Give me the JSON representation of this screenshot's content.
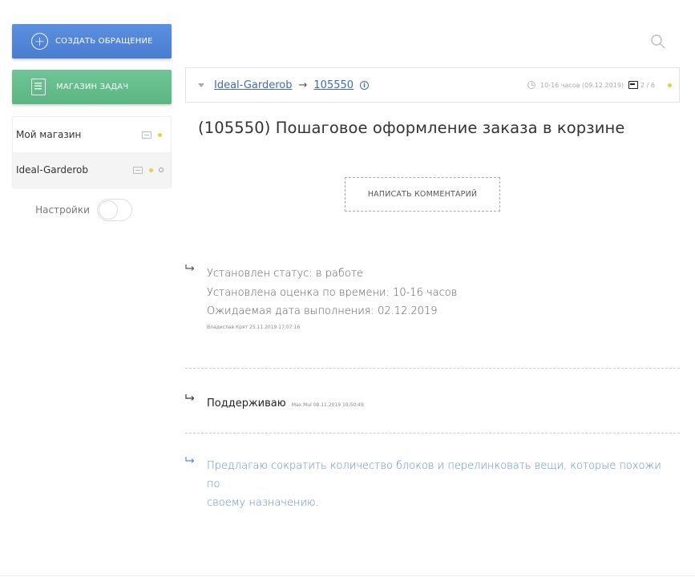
{
  "sidebar": {
    "create_label": "СОЗДАТЬ ОБРАЩЕНИЕ",
    "store_label": "МАГАЗИН ЗАДАЧ",
    "stores": [
      {
        "name": "Мой магазин"
      },
      {
        "name": "Ideal-Garderob"
      }
    ],
    "settings_label": "Настройки"
  },
  "breadcrumb": {
    "store": "Ideal-Garderob",
    "arrow": "→",
    "ticket": "105550",
    "info_glyph": "i",
    "estimate": "10-16 часов (09.12.2019)",
    "messages": "2 / 6"
  },
  "title": "(105550) Пошаговое оформление заказа в корзине",
  "write_comment_label": "НАПИСАТЬ КОММЕНТАРИЙ",
  "feed": {
    "status_lines": [
      "Установлен статус: в работе",
      "Установлена оценка по времени: 10-16 часов",
      "Ожидаемая дата выполнения: 02.12.2019"
    ],
    "status_author": "Владислав Крят 25.11.2019 17:07:16",
    "comment2_text": "Поддерживаю",
    "comment2_author": "Max Mul 08.11.2019 10:50:49",
    "comment3_lines": [
      "Предлагаю сократить количество блоков и перелинковать вещи, которые похожи по",
      "своему назначению."
    ]
  },
  "colors": {
    "create_button": "#5b8fdf",
    "store_button": "#6fc595",
    "link": "#3d6bb8",
    "dot": "#f2c94c",
    "suggestion_text": "#5b8bc9"
  }
}
